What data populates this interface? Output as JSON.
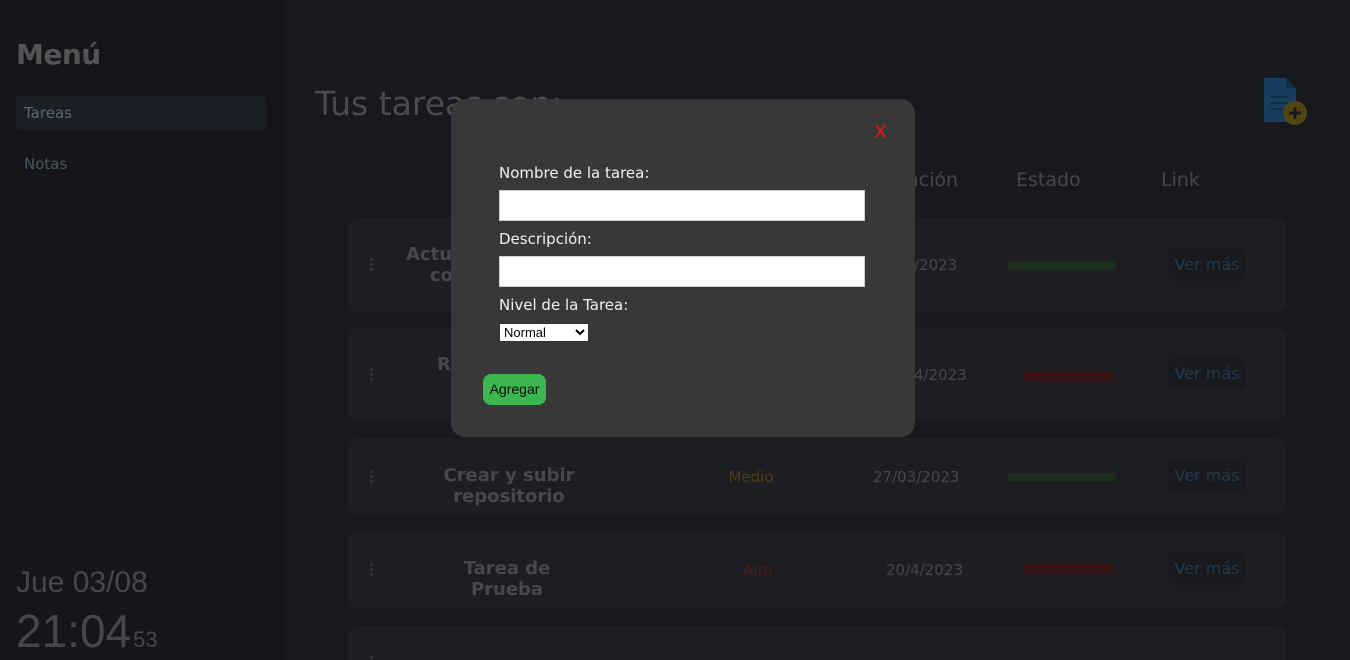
{
  "sidebar": {
    "title": "Menú",
    "items": [
      {
        "label": "Tareas",
        "active": true
      },
      {
        "label": "Notas",
        "active": false
      }
    ],
    "clock": {
      "date": "Jue 03/08",
      "time": "21:04",
      "seconds": "53"
    }
  },
  "main": {
    "title": "Tus tareas son:",
    "columns": [
      "ación",
      "Estado",
      "Link"
    ],
    "tasks": [
      {
        "name_line1": "Actu",
        "name_line2": "co",
        "level": "",
        "date": "/2023",
        "state": "",
        "link": "Ver más"
      },
      {
        "name_line1": "R",
        "name_line2": "",
        "level": "",
        "date": "4/2023",
        "state": "",
        "link": "Ver más"
      },
      {
        "name_line1": "Crear y subir repositorio",
        "name_line2": "",
        "level": "Medio",
        "date": "27/03/2023",
        "state": "",
        "link": "Ver más"
      },
      {
        "name_line1": "Tarea de Prueba",
        "name_line2": "",
        "level": "Alto",
        "date": "20/4/2023",
        "state": "",
        "link": "Ver más"
      },
      {
        "name_line1": "",
        "name_line2": "",
        "level": "",
        "date": "",
        "state": "",
        "link": ""
      }
    ]
  },
  "modal": {
    "close_label": "X",
    "name_label": "Nombre de la tarea:",
    "name_value": "",
    "desc_label": "Descripción:",
    "desc_value": "",
    "level_label": "Nivel de la Tarea:",
    "level_selected": "Normal",
    "submit_label": "Agregar"
  },
  "colors": {
    "modal_bg": "#383838",
    "close": "#e8150c",
    "submit": "#3cb64f",
    "level_medio": "#6b4a1f",
    "level_alto": "#6b1f1f",
    "state_green": "#2a4a26",
    "state_red": "#5c1e1e"
  }
}
